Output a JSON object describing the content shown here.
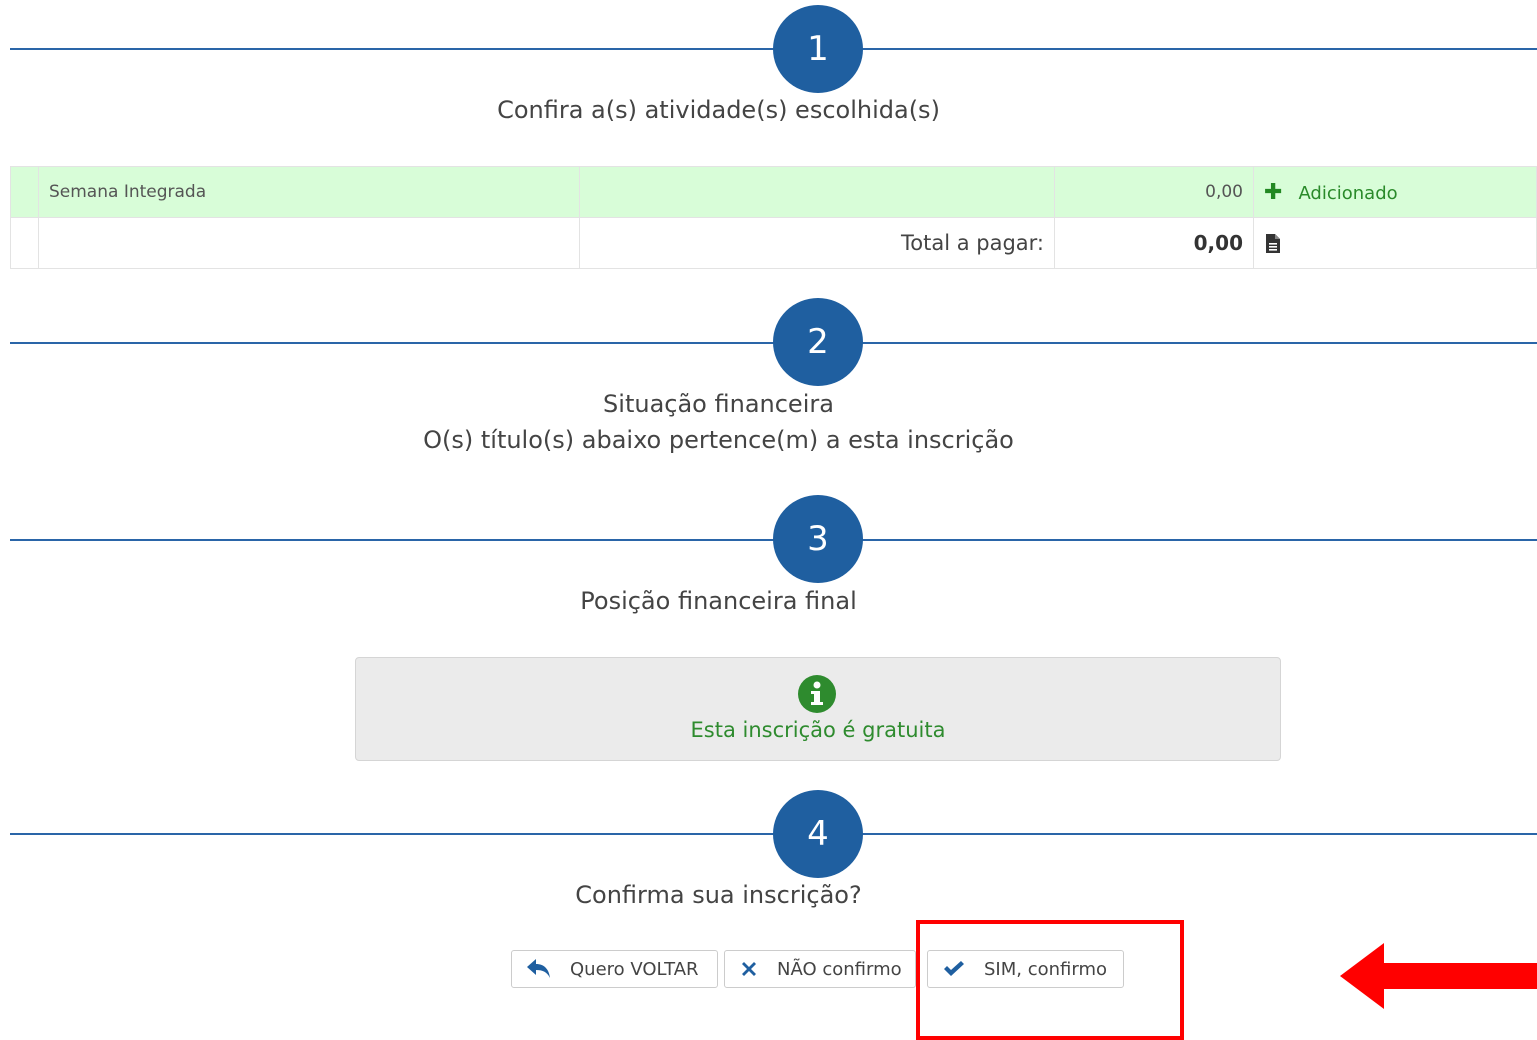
{
  "steps": [
    {
      "number": "1",
      "title": "Confira a(s) atividade(s) escolhida(s)"
    },
    {
      "number": "2",
      "title": "Situação financeira",
      "subtitle": "O(s) título(s) abaixo pertence(m) a esta inscrição"
    },
    {
      "number": "3",
      "title": "Posição financeira final"
    },
    {
      "number": "4",
      "title": "Confirma sua inscrição?"
    }
  ],
  "activities_table": {
    "rows": [
      {
        "name": "Semana Integrada",
        "value": "0,00",
        "status": "Adicionado",
        "status_icon": "plus-icon"
      }
    ],
    "total_label": "Total a pagar:",
    "total_value": "0,00",
    "total_icon": "document-icon"
  },
  "info_box": {
    "icon": "info-circle-icon",
    "message": "Esta inscrição é gratuita"
  },
  "buttons": {
    "back": {
      "label": "Quero VOLTAR",
      "icon": "reply-arrow-icon"
    },
    "no": {
      "label": "NÃO confirmo",
      "icon": "x-icon"
    },
    "yes": {
      "label": "SIM, confirmo",
      "icon": "check-icon"
    }
  },
  "colors": {
    "step_blue": "#1f5fa0",
    "row_highlight": "#d8fdd8",
    "success_green": "#2e8b2e",
    "annotation_red": "#ff0000"
  }
}
